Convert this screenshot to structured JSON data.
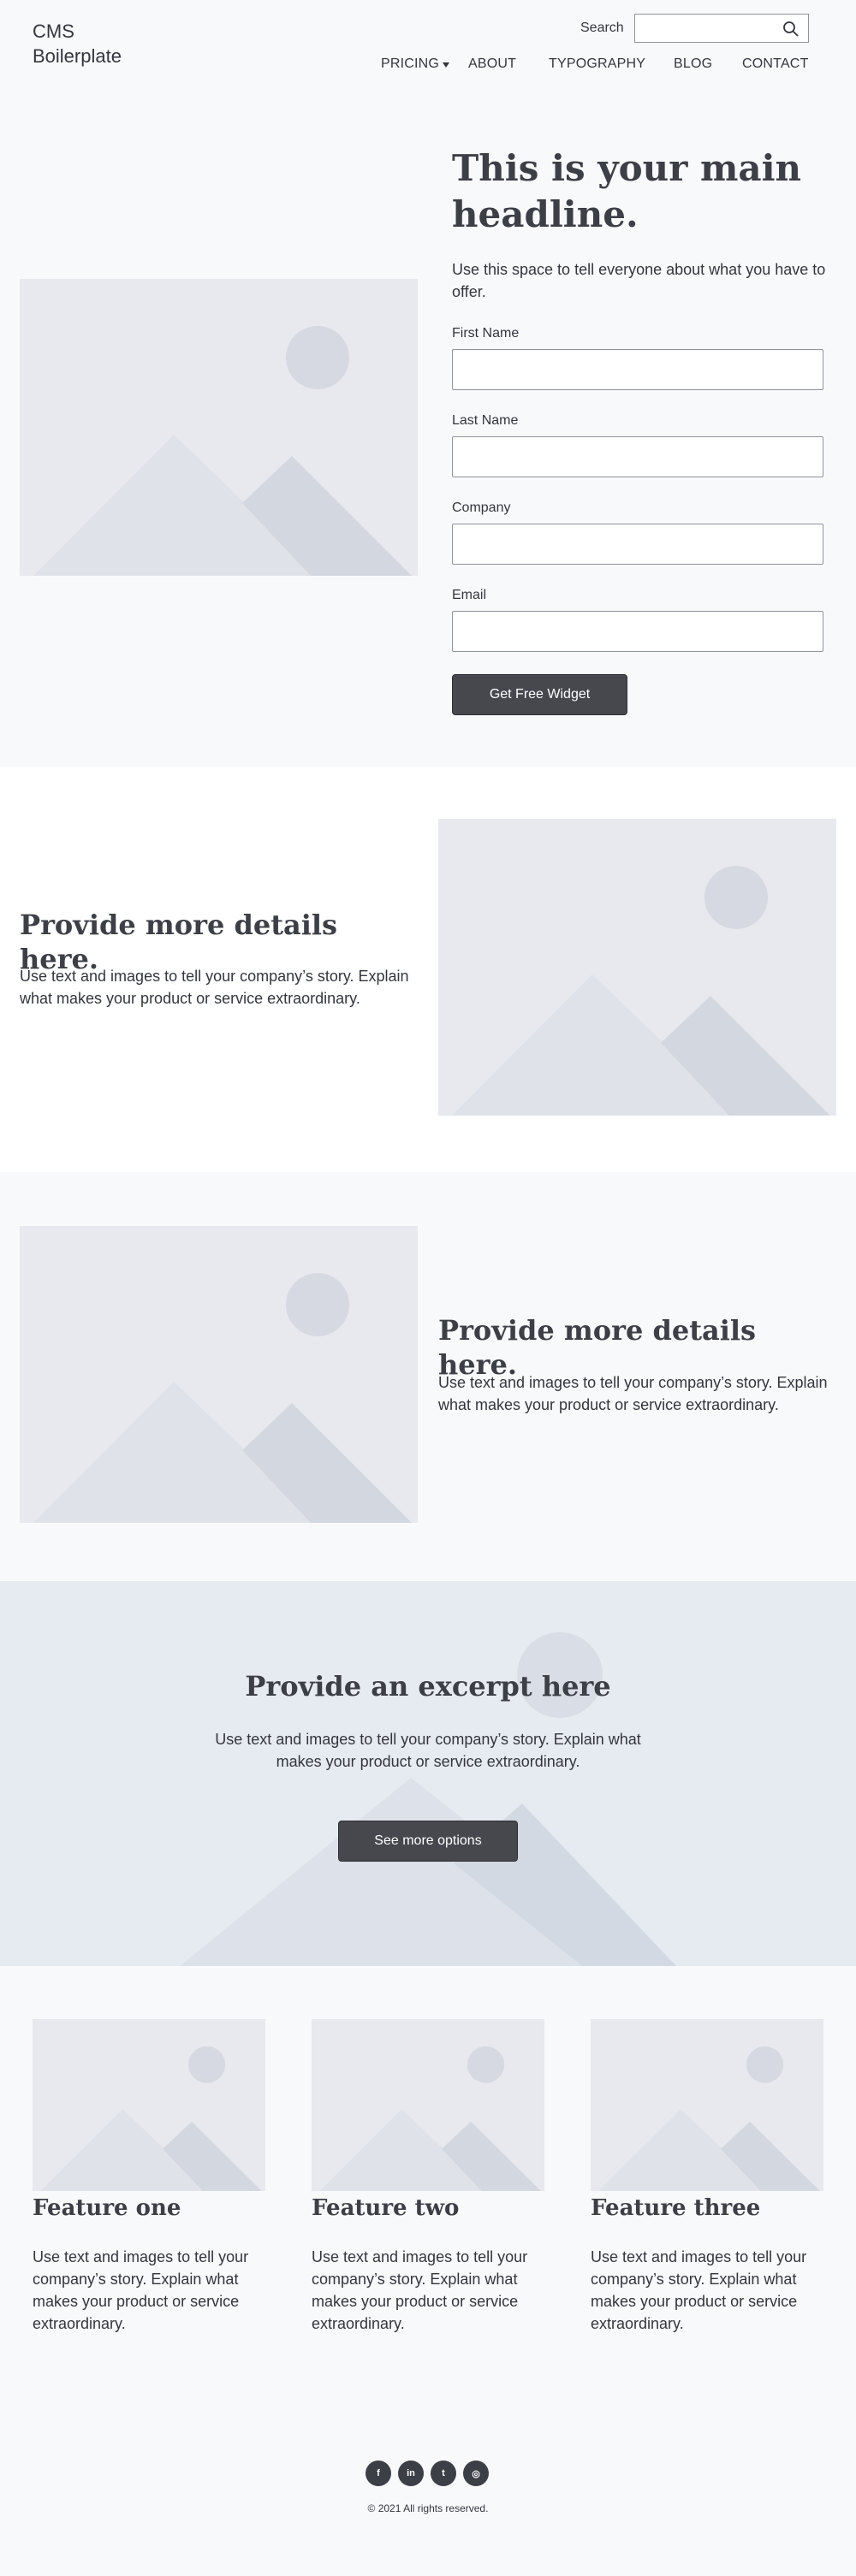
{
  "header": {
    "logo": "CMS Boilerplate",
    "search_label": "Search",
    "search_placeholder": "",
    "nav": [
      "PRICING",
      "ABOUT",
      "TYPOGRAPHY",
      "BLOG",
      "CONTACT"
    ]
  },
  "hero": {
    "title": "This is your main headline.",
    "subtitle": "Use this space to tell everyone about what you have to offer.",
    "form": {
      "fields": [
        {
          "label": "First Name",
          "value": ""
        },
        {
          "label": "Last Name",
          "value": ""
        },
        {
          "label": "Company",
          "value": ""
        },
        {
          "label": "Email",
          "value": ""
        }
      ],
      "submit_label": "Get Free Widget"
    }
  },
  "details": [
    {
      "title": "Provide more details here.",
      "body": "Use text and images to tell your company’s story. Explain what makes your product or service extraordinary."
    },
    {
      "title": "Provide more details here.",
      "body": "Use text and images to tell your company’s story. Explain what makes your product or service extraordinary."
    }
  ],
  "excerpt": {
    "title": "Provide an excerpt here",
    "body": "Use text and images to tell your company’s story. Explain what makes your product or service extraordinary.",
    "cta_label": "See more options"
  },
  "features": [
    {
      "title": "Feature one",
      "body": "Use text and images to tell your company’s story. Explain what makes your product or service extraordinary."
    },
    {
      "title": "Feature two",
      "body": "Use text and images to tell your company’s story. Explain what makes your product or service extraordinary."
    },
    {
      "title": "Feature three",
      "body": "Use text and images to tell your company’s story. Explain what makes your product or service extraordinary."
    }
  ],
  "footer": {
    "social": [
      {
        "icon": "facebook-icon",
        "glyph": "f"
      },
      {
        "icon": "linkedin-icon",
        "glyph": "in"
      },
      {
        "icon": "twitter-icon",
        "glyph": "t"
      },
      {
        "icon": "instagram-icon",
        "glyph": "◎"
      }
    ],
    "copyright": "© 2021 All rights reserved."
  },
  "colors": {
    "page_bg": "#f8f9fb",
    "button_bg": "#46484e",
    "placeholder_bg": "#e7e9ee",
    "excerpt_bg": "#e6ebf2"
  }
}
